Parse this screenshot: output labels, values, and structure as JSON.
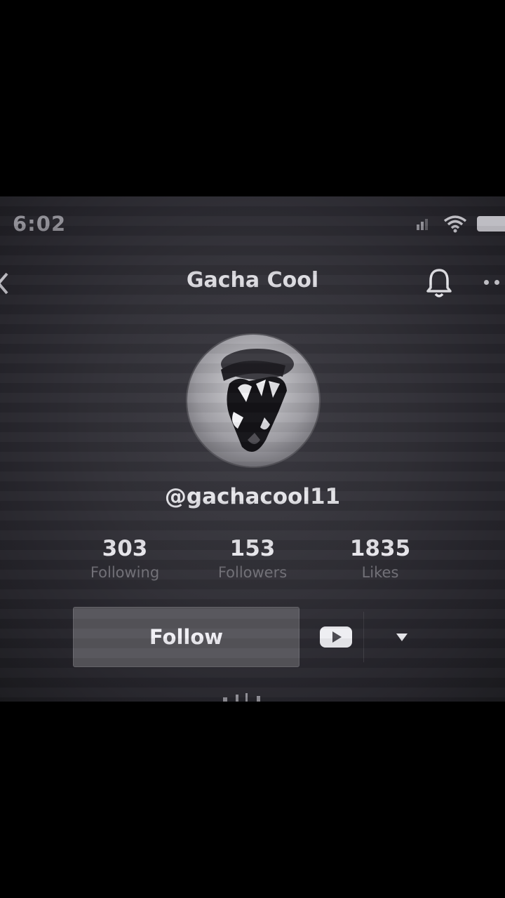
{
  "status_bar": {
    "time": "6:02"
  },
  "header": {
    "title": "Gacha Cool"
  },
  "profile": {
    "username": "@gachacool11",
    "stats": [
      {
        "value": "303",
        "label": "Following"
      },
      {
        "value": "153",
        "label": "Followers"
      },
      {
        "value": "1835",
        "label": "Likes"
      }
    ]
  },
  "actions": {
    "follow_label": "Follow"
  },
  "icons": {
    "back": "chevron-left-icon",
    "bell": "bell-icon",
    "more": "more-dots-icon",
    "youtube": "youtube-icon",
    "dropdown": "triangle-down-icon",
    "signal": "signal-icon",
    "wifi": "wifi-icon",
    "battery": "battery-icon"
  },
  "colors": {
    "background": "#2f2e35",
    "follow_button": "#56555b",
    "text_primary": "#e8e7ec",
    "text_secondary": "#6f6e75"
  }
}
